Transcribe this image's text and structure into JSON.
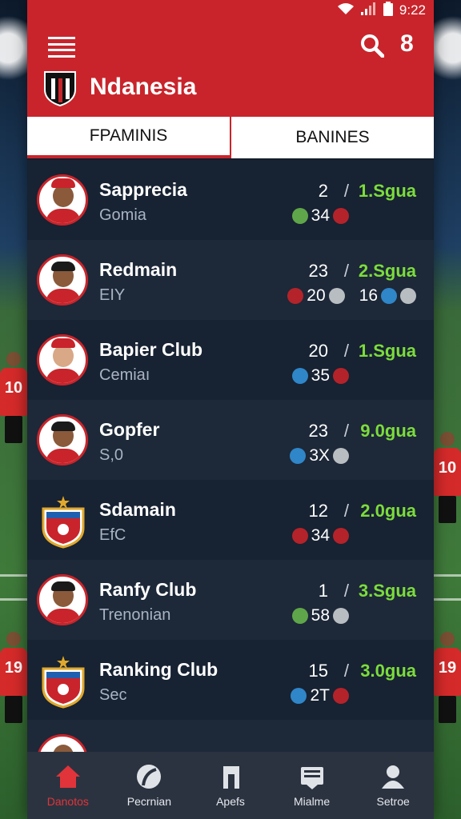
{
  "status_bar": {
    "time": "9:22"
  },
  "header": {
    "title": "Ndanesia",
    "notification_count": "8"
  },
  "tabs": [
    {
      "label": "FPAMINIS",
      "active": true
    },
    {
      "label": "BANINES",
      "active": false
    }
  ],
  "clubs": [
    {
      "name": "Sapprecia",
      "subtitle": "Gomia",
      "rank": "2",
      "league": "1.Sgua",
      "stats": [
        {
          "icon": "green",
          "value": "34"
        },
        {
          "icon": "red",
          "value": ""
        }
      ]
    },
    {
      "name": "Redmain",
      "subtitle": "EIY",
      "rank": "23",
      "league": "2.Sgua",
      "stats": [
        {
          "icon": "red",
          "value": "20"
        },
        {
          "icon": "grey",
          "value": ""
        },
        {
          "icon": "",
          "value": "16"
        },
        {
          "icon": "blue",
          "value": ""
        },
        {
          "icon": "grey",
          "value": ""
        }
      ]
    },
    {
      "name": "Bapier Club",
      "subtitle": "Cemiaı",
      "rank": "20",
      "league": "1.Sgua",
      "stats": [
        {
          "icon": "blue",
          "value": "35"
        },
        {
          "icon": "red",
          "value": ""
        }
      ]
    },
    {
      "name": "Gopfer",
      "subtitle": "S,0",
      "rank": "23",
      "league": "9.0gua",
      "stats": [
        {
          "icon": "blue",
          "value": "3X"
        },
        {
          "icon": "grey",
          "value": ""
        }
      ]
    },
    {
      "name": "Sdamain",
      "subtitle": "EfC",
      "rank": "12",
      "league": "2.0gua",
      "stats": [
        {
          "icon": "red",
          "value": "34"
        },
        {
          "icon": "red",
          "value": ""
        }
      ]
    },
    {
      "name": "Ranfy Club",
      "subtitle": "Trenonian",
      "rank": "1",
      "league": "3.Sgua",
      "stats": [
        {
          "icon": "green",
          "value": "58"
        },
        {
          "icon": "grey",
          "value": ""
        }
      ]
    },
    {
      "name": "Ranking Club",
      "subtitle": "Sec",
      "rank": "15",
      "league": "3.0gua",
      "stats": [
        {
          "icon": "blue",
          "value": "2T"
        },
        {
          "icon": "red",
          "value": ""
        }
      ]
    }
  ],
  "nav": [
    {
      "label": "Danotos",
      "icon": "home-icon",
      "active": true
    },
    {
      "label": "Pecrnian",
      "icon": "ball-icon",
      "active": false
    },
    {
      "label": "Apefs",
      "icon": "music-icon",
      "active": false
    },
    {
      "label": "Mialme",
      "icon": "news-icon",
      "active": false
    },
    {
      "label": "Setroe",
      "icon": "person-icon",
      "active": false
    }
  ],
  "colors": {
    "brand_red": "#c9242b",
    "league_green": "#7cdc3c",
    "panel_dark": "#141d2b"
  }
}
